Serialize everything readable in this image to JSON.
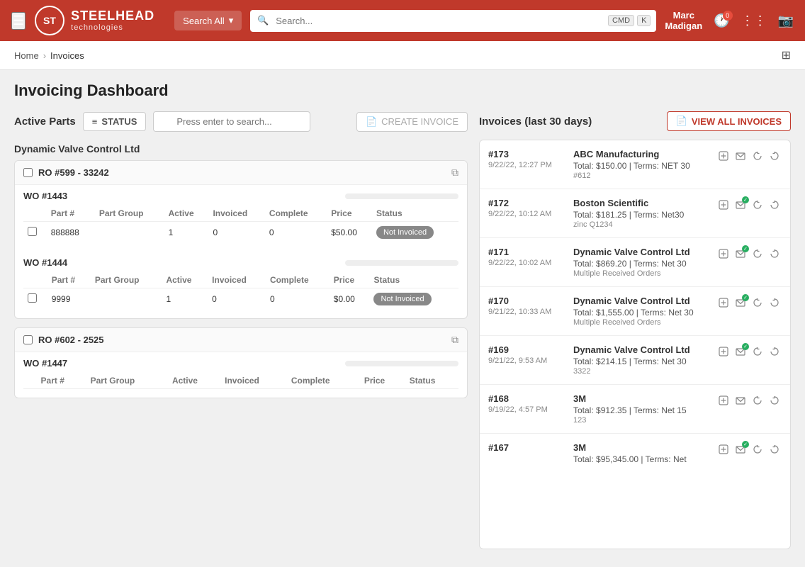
{
  "topnav": {
    "logo_brand": "STEELHEAD",
    "logo_sub": "technologies",
    "search_all_label": "Search All",
    "search_placeholder": "Search...",
    "kbd1": "CMD",
    "kbd2": "K",
    "user_name": "Marc\nMadigan",
    "notification_badge": "0"
  },
  "breadcrumb": {
    "home": "Home",
    "current": "Invoices"
  },
  "page": {
    "title": "Invoicing Dashboard"
  },
  "left": {
    "active_parts_label": "Active Parts",
    "status_btn": "STATUS",
    "search_placeholder": "Press enter to search...",
    "create_invoice_btn": "CREATE INVOICE",
    "company": "Dynamic Valve Control Ltd",
    "ro_cards": [
      {
        "ro_label": "RO #599 - 33242",
        "wo_blocks": [
          {
            "wo_label": "WO #1443",
            "progress": 0,
            "columns": [
              "Part #",
              "Part Group",
              "Active",
              "Invoiced",
              "Complete",
              "Price",
              "Status"
            ],
            "parts": [
              {
                "part_num": "888888",
                "part_group": "",
                "active": "1",
                "invoiced": "0",
                "complete": "0",
                "price": "$50.00",
                "status": "Not Invoiced"
              }
            ]
          },
          {
            "wo_label": "WO #1444",
            "progress": 0,
            "columns": [
              "Part #",
              "Part Group",
              "Active",
              "Invoiced",
              "Complete",
              "Price",
              "Status"
            ],
            "parts": [
              {
                "part_num": "9999",
                "part_group": "",
                "active": "1",
                "invoiced": "0",
                "complete": "0",
                "price": "$0.00",
                "status": "Not Invoiced"
              }
            ]
          }
        ]
      },
      {
        "ro_label": "RO #602 - 2525",
        "wo_blocks": [
          {
            "wo_label": "WO #1447",
            "progress": 0,
            "columns": [
              "Part #",
              "Part Group",
              "Active",
              "Invoiced",
              "Complete",
              "Price",
              "Status"
            ],
            "parts": []
          }
        ]
      }
    ]
  },
  "right": {
    "invoices_label": "Invoices (last 30 days)",
    "view_all_btn": "VIEW ALL INVOICES",
    "invoices": [
      {
        "id": "#173",
        "date": "9/22/22, 12:27 PM",
        "company": "ABC Manufacturing",
        "total_terms": "Total: $150.00 | Terms: NET 30",
        "ref": "#612",
        "has_check": false,
        "actions": [
          "edit",
          "email",
          "refresh",
          "undo"
        ]
      },
      {
        "id": "#172",
        "date": "9/22/22, 10:12 AM",
        "company": "Boston Scientific",
        "total_terms": "Total: $181.25 | Terms: Net30",
        "ref": "zinc Q1234",
        "has_check": true,
        "actions": [
          "edit",
          "email",
          "refresh",
          "undo"
        ]
      },
      {
        "id": "#171",
        "date": "9/22/22, 10:02 AM",
        "company": "Dynamic Valve Control Ltd",
        "total_terms": "Total: $869.20 | Terms: Net 30",
        "ref": "Multiple Received Orders",
        "has_check": true,
        "actions": [
          "edit",
          "email",
          "refresh",
          "undo"
        ]
      },
      {
        "id": "#170",
        "date": "9/21/22, 10:33 AM",
        "company": "Dynamic Valve Control Ltd",
        "total_terms": "Total: $1,555.00 | Terms: Net 30",
        "ref": "Multiple Received Orders",
        "has_check": true,
        "actions": [
          "edit",
          "email",
          "refresh",
          "undo"
        ]
      },
      {
        "id": "#169",
        "date": "9/21/22, 9:53 AM",
        "company": "Dynamic Valve Control Ltd",
        "total_terms": "Total: $214.15 | Terms: Net 30",
        "ref": "3322",
        "has_check": true,
        "actions": [
          "edit",
          "email",
          "refresh",
          "undo"
        ]
      },
      {
        "id": "#168",
        "date": "9/19/22, 4:57 PM",
        "company": "3M",
        "total_terms": "Total: $912.35 | Terms: Net 15",
        "ref": "123",
        "has_check": false,
        "actions": [
          "edit",
          "email",
          "refresh",
          "undo"
        ]
      },
      {
        "id": "#167",
        "date": "",
        "company": "3M",
        "total_terms": "Total: $95,345.00 | Terms: Net",
        "ref": "",
        "has_check": true,
        "actions": [
          "edit",
          "email",
          "refresh",
          "undo"
        ]
      }
    ]
  }
}
